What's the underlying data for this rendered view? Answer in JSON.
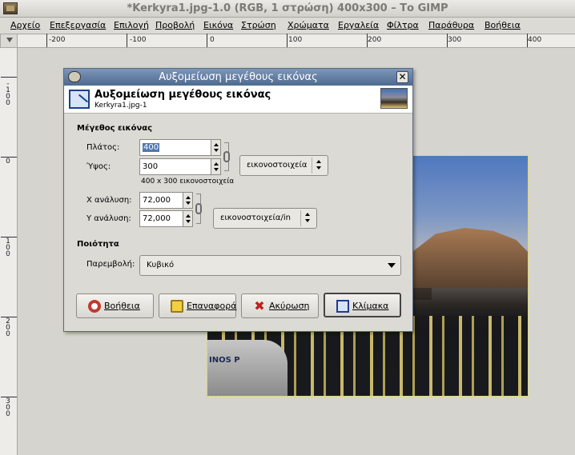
{
  "window": {
    "title": "*Kerkyra1.jpg-1.0 (RGB, 1 στρώση) 400x300 – Το GIMP"
  },
  "menubar": {
    "items": [
      "Αρχείο",
      "Επεξεργασία",
      "Επιλογή",
      "Προβολή",
      "Εικόνα",
      "Στρώση",
      "Χρώματα",
      "Εργαλεία",
      "Φίλτρα",
      "Παράθυρα",
      "Βοήθεια"
    ]
  },
  "ruler": {
    "h_labels": [
      "-200",
      "-100",
      "0",
      "100",
      "200",
      "300",
      "400"
    ],
    "v_labels": [
      "-100",
      "0",
      "100",
      "200",
      "300"
    ]
  },
  "photo": {
    "boat_text": "INOS P"
  },
  "dialog": {
    "title": "Αυξομείωση μεγέθους εικόνας",
    "header_title": "Αυξομείωση μεγέθους εικόνας",
    "header_subtitle": "Kerkyra1.jpg-1",
    "close_label": "✕",
    "image_size_section": "Μέγεθος εικόνας",
    "width_label": "Πλάτος:",
    "width_value": "400",
    "height_label": "Ύψος:",
    "height_value": "300",
    "size_note": "400 x 300 εικονοστοιχεία",
    "size_unit": "εικονοστοιχεία",
    "x_res_label": "Χ ανάλυση:",
    "x_res_value": "72,000",
    "y_res_label": "Υ ανάλυση:",
    "y_res_value": "72,000",
    "res_unit": "εικονοστοιχεία/in",
    "quality_section": "Ποιότητα",
    "interp_label": "Παρεμβολή:",
    "interp_value": "Κυβικό",
    "buttons": {
      "help": "Βοήθεια",
      "reset": "Επαναφορά",
      "cancel": "Ακύρωση",
      "scale": "Κλίμακα"
    }
  },
  "colors": {
    "dialog_title_bg": "#4e6a90",
    "selection_highlight": "#5077b0",
    "selection_outline": "#e2d84a"
  }
}
